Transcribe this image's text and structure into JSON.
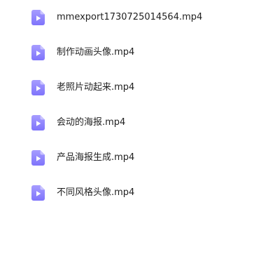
{
  "file_list": {
    "icon": "video-file-icon",
    "icon_color": "#8b82ff",
    "files": [
      {
        "name": "mmexport1730725014564.mp4"
      },
      {
        "name": "制作动画头像.mp4"
      },
      {
        "name": "老照片动起来.mp4"
      },
      {
        "name": "会动的海报.mp4"
      },
      {
        "name": "产品海报生成.mp4"
      },
      {
        "name": "不同风格头像.mp4"
      }
    ]
  }
}
